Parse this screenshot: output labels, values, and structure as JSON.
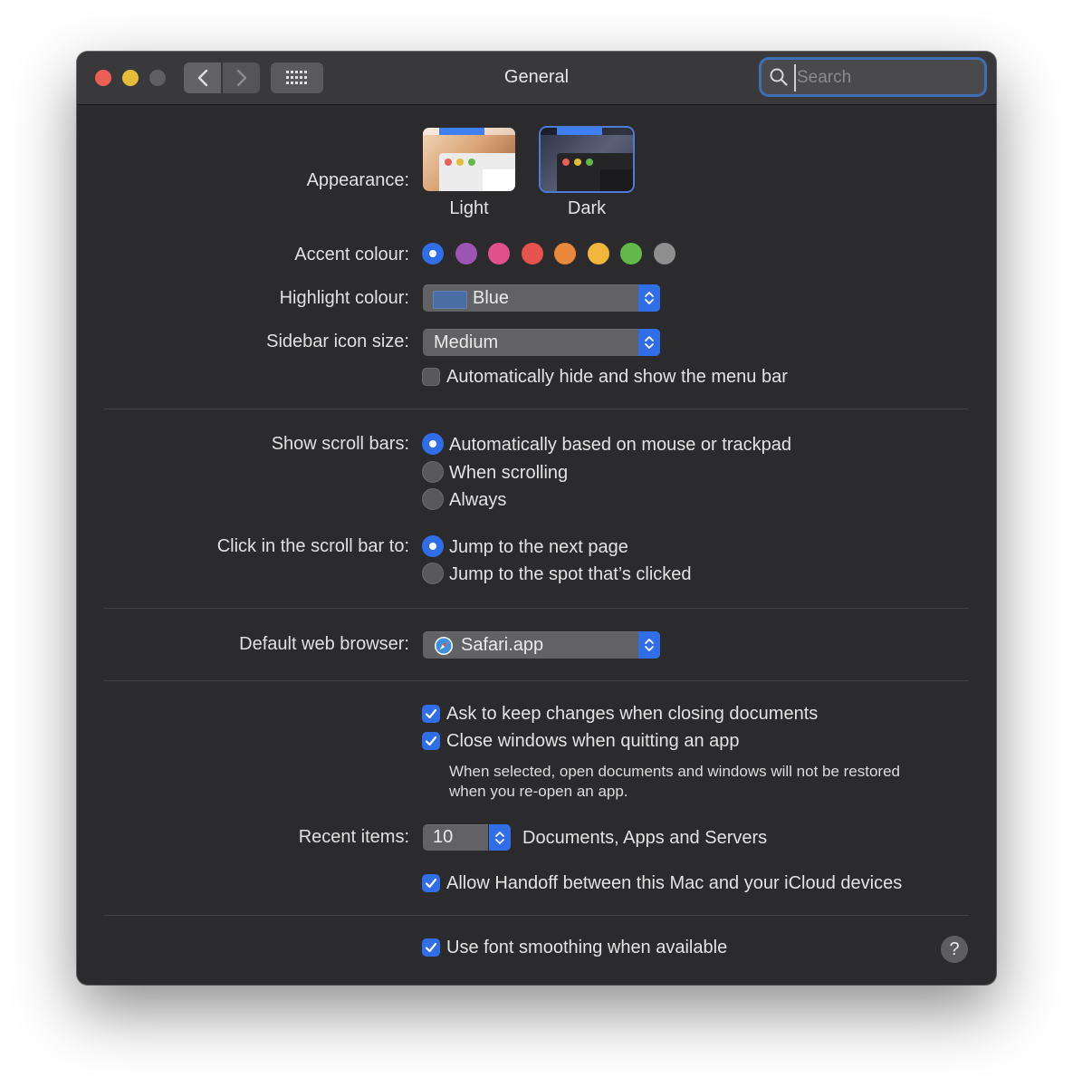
{
  "window": {
    "title": "General",
    "search_placeholder": "Search"
  },
  "appearance": {
    "label": "Appearance:",
    "options": [
      "Light",
      "Dark"
    ],
    "selected": "Dark"
  },
  "accent": {
    "label": "Accent colour:",
    "colors": [
      "#2f6ee6",
      "#9b56b3",
      "#e2508c",
      "#e6534c",
      "#e8873a",
      "#f0b73b",
      "#62b94a",
      "#8e8e8e"
    ],
    "selected_index": 0
  },
  "highlight": {
    "label": "Highlight colour:",
    "value": "Blue"
  },
  "sidebar_icon": {
    "label": "Sidebar icon size:",
    "value": "Medium"
  },
  "menu_bar": {
    "label": "Automatically hide and show the menu bar",
    "checked": false
  },
  "scroll_bars": {
    "label": "Show scroll bars:",
    "options": [
      "Automatically based on mouse or trackpad",
      "When scrolling",
      "Always"
    ],
    "selected_index": 0
  },
  "click_scroll": {
    "label": "Click in the scroll bar to:",
    "options": [
      "Jump to the next page",
      "Jump to the spot that’s clicked"
    ],
    "selected_index": 0
  },
  "browser": {
    "label": "Default web browser:",
    "value": "Safari.app"
  },
  "documents": {
    "ask_keep": "Ask to keep changes when closing documents",
    "close_windows": "Close windows when quitting an app",
    "note_line1": "When selected, open documents and windows will not be restored",
    "note_line2": "when you re-open an app."
  },
  "recent": {
    "label": "Recent items:",
    "value": "10",
    "suffix": "Documents, Apps and Servers"
  },
  "handoff": {
    "label": "Allow Handoff between this Mac and your iCloud devices"
  },
  "font_smoothing": {
    "label": "Use font smoothing when available"
  },
  "help": {
    "glyph": "?"
  }
}
